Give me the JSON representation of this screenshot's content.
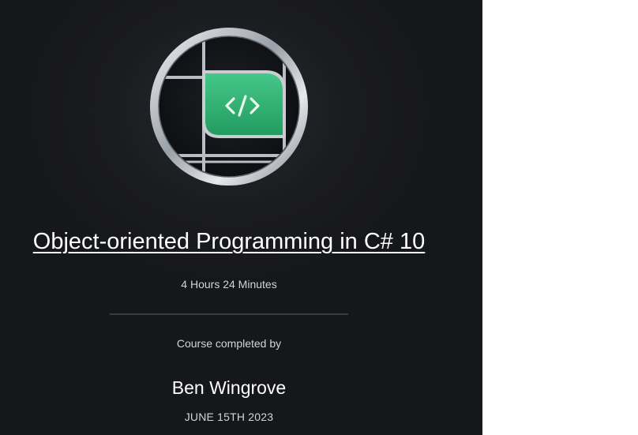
{
  "certificate": {
    "badge_icon": "code-brackets-icon",
    "course_title": "Object-oriented Programming in C# 10",
    "duration": "4 Hours 24 Minutes",
    "completed_label": "Course completed by",
    "learner_name": "Ben Wingrove",
    "completion_date": "JUNE 15TH 2023"
  },
  "colors": {
    "background": "#16171b",
    "accent_green": "#3ec27a",
    "text_primary": "#ffffff",
    "text_secondary": "#d3d4d8"
  }
}
